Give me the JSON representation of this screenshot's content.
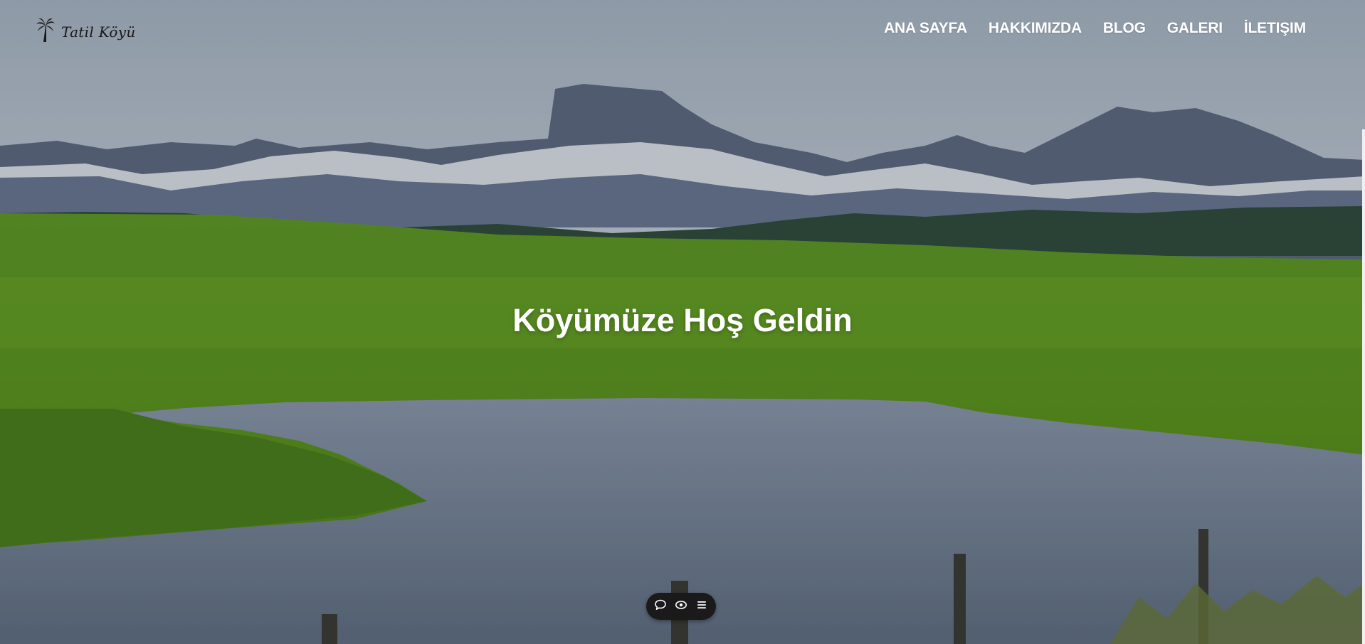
{
  "site": {
    "logo_text": "Tatil Köyü",
    "logo_icon": "palm-tree-icon"
  },
  "nav": {
    "items": [
      {
        "label": "ANA SAYFA"
      },
      {
        "label": "HAKKIMIZDA"
      },
      {
        "label": "BLOG"
      },
      {
        "label": "GALERI"
      },
      {
        "label": "İLETIŞIM"
      }
    ]
  },
  "hero": {
    "title": "Köyümüze Hoş Geldin",
    "background": "mountain-lake-landscape"
  },
  "floating_toolbar": {
    "buttons": [
      {
        "icon": "comment-icon"
      },
      {
        "icon": "eye-icon"
      },
      {
        "icon": "menu-icon"
      }
    ]
  },
  "colors": {
    "nav_text": "#ffffff",
    "title_text": "#ffffff",
    "toolbar_bg": "#1a1a1a"
  }
}
